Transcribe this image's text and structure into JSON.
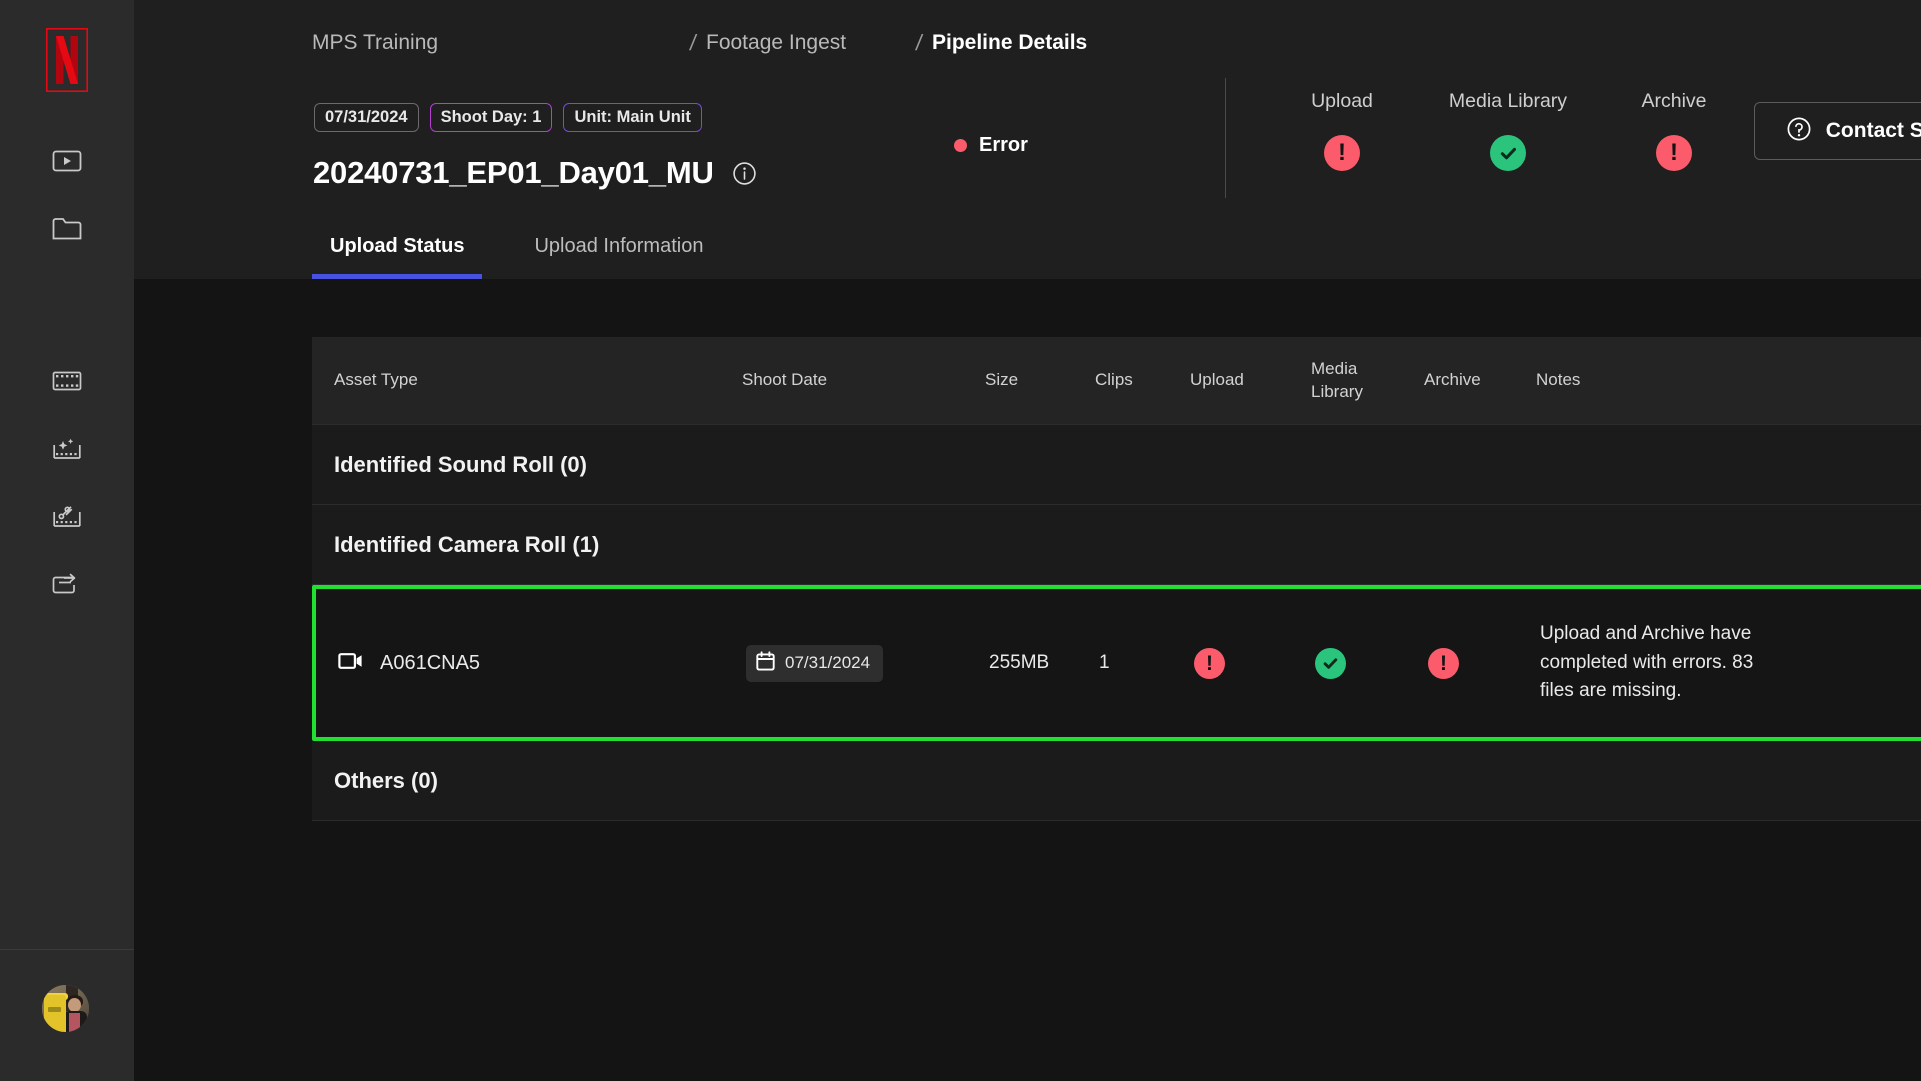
{
  "sidebar": {
    "logo": "netflix-logo",
    "items": [
      {
        "icon": "video-player-icon",
        "name": "sidebar-item-player"
      },
      {
        "icon": "folder-icon",
        "name": "sidebar-item-folder"
      },
      {
        "icon": "film-strip-icon",
        "name": "sidebar-item-film-strip"
      },
      {
        "icon": "film-sparkle-icon",
        "name": "sidebar-item-film-effects"
      },
      {
        "icon": "film-scissors-icon",
        "name": "sidebar-item-film-edit"
      },
      {
        "icon": "clapperboard-arrow-icon",
        "name": "sidebar-item-clapperboard"
      }
    ],
    "avatar_label": "user-avatar"
  },
  "header": {
    "breadcrumb": [
      {
        "label": "MPS Training",
        "current": false
      },
      {
        "label": "Footage Ingest",
        "current": false
      },
      {
        "label": "Pipeline Details",
        "current": true
      }
    ],
    "separator": "/",
    "badges": [
      {
        "label": "07/31/2024",
        "style": "gray"
      },
      {
        "label": "Shoot Day: 1",
        "style": "magenta"
      },
      {
        "label": "Unit: Main Unit",
        "style": "violet"
      }
    ],
    "title": "20240731_EP01_Day01_MU",
    "info_icon": "info-circle-icon",
    "status": {
      "label": "Error",
      "color": "#fb5b6a"
    },
    "pipeline_steps": [
      {
        "label": "Upload",
        "state": "error"
      },
      {
        "label": "Media Library",
        "state": "ok"
      },
      {
        "label": "Archive",
        "state": "error"
      }
    ],
    "support_button": {
      "label": "Contact Support",
      "icon": "question-circle-icon"
    },
    "tabs": [
      {
        "label": "Upload Status",
        "active": true
      },
      {
        "label": "Upload Information",
        "active": false
      }
    ]
  },
  "table": {
    "columns": [
      "Asset Type",
      "Shoot Date",
      "Size",
      "Clips",
      "Upload",
      "Media\nLibrary",
      "Archive",
      "Notes"
    ],
    "groups": [
      {
        "label": "Identified Sound Roll (0)"
      },
      {
        "label": "Identified Camera Roll (1)"
      },
      {
        "label": "Others (0)"
      }
    ],
    "row": {
      "asset_icon": "camera-video-icon",
      "asset_name": "A061CNA5",
      "date_icon": "calendar-icon",
      "shoot_date": "07/31/2024",
      "size": "255MB",
      "clips": "1",
      "upload_state": "error",
      "media_library_state": "ok",
      "archive_state": "error",
      "notes": "Upload and Archive have completed with errors. 83 files are missing.",
      "highlight_color": "#22e032"
    }
  },
  "colors": {
    "error": "#fb5b6a",
    "success": "#2bc47d",
    "accent_tab": "#4752e0",
    "netflix_red": "#e50914",
    "highlight": "#22e032"
  }
}
